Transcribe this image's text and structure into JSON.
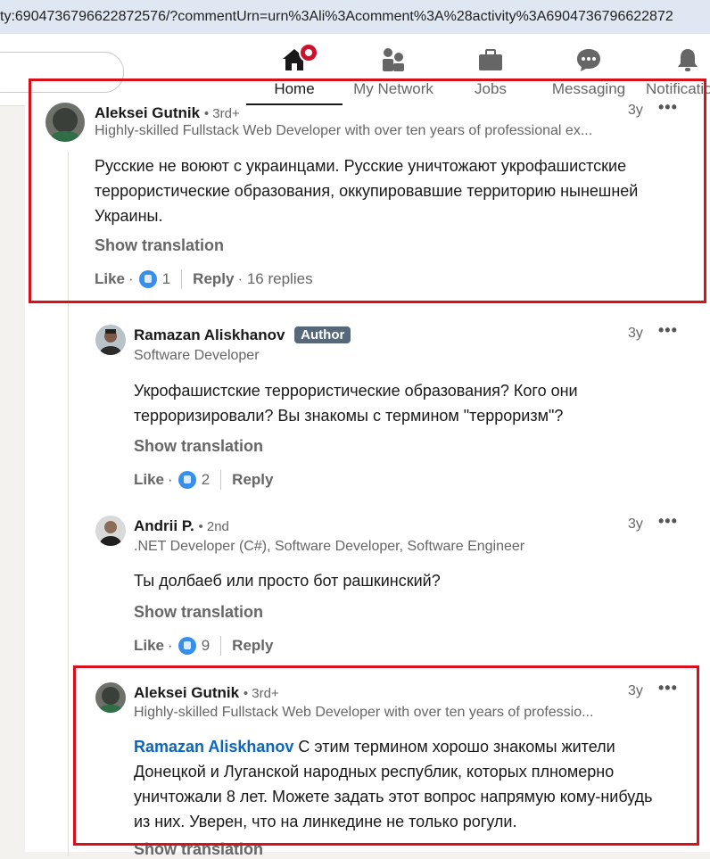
{
  "browser": {
    "url": "ty:6904736796622872576/?commentUrn=urn%3Ali%3Acomment%3A%28activity%3A6904736796622872"
  },
  "nav": {
    "home": "Home",
    "network": "My Network",
    "jobs": "Jobs",
    "messaging": "Messaging",
    "notifications": "Notificatio"
  },
  "comments": [
    {
      "name": "Aleksei Gutnik",
      "degree": "• 3rd+",
      "headline": "Highly-skilled Fullstack Web Developer with over ten years of professional ex...",
      "time": "3y",
      "text": "Русские не воюют с украинцами. Русские уничтожают укрофашистские террористические образования, оккупировавшие территорию нынешней Украины.",
      "show_translation": "Show translation",
      "like": "Like",
      "dot": "·",
      "like_count": "1",
      "reply": "Reply",
      "replies": "· 16 replies"
    },
    {
      "name": "Ramazan Aliskhanov",
      "author_badge": "Author",
      "headline": "Software Developer",
      "time": "3y",
      "text": "Укрофашистские террористические образования? Кого они терроризировали? Вы знакомы с термином \"терроризм\"?",
      "show_translation": "Show translation",
      "like": "Like",
      "dot": "·",
      "like_count": "2",
      "reply": "Reply"
    },
    {
      "name": "Andrii P.",
      "degree": "• 2nd",
      "headline": ".NET Developer (C#), Software Developer, Software Engineer",
      "time": "3y",
      "text": "Ты долбаеб или просто бот рашкинский?",
      "show_translation": "Show translation",
      "like": "Like",
      "dot": "·",
      "like_count": "9",
      "reply": "Reply"
    },
    {
      "name": "Aleksei Gutnik",
      "degree": "• 3rd+",
      "headline": "Highly-skilled Fullstack Web Developer with over ten years of professio...",
      "time": "3y",
      "mention": "Ramazan Aliskhanov",
      "text": " С этим термином хорошо знакомы жители Донецкой и Луганской народных республик, которых плномерно уничтожали 8 лет. Можете задать этот вопрос напрямую кому-нибудь из них. Уверен, что на линкедине не только рогули.",
      "show_translation": "Show translation"
    }
  ],
  "colors": {
    "highlight_box": "#d7101a",
    "link": "#0a66c2",
    "author_badge": "#56687a"
  }
}
